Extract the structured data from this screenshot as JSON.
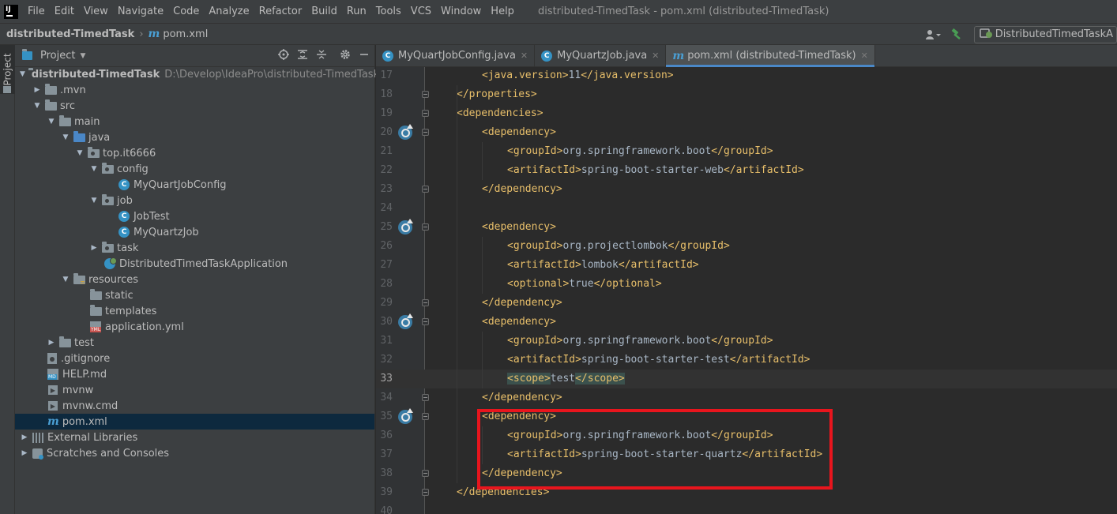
{
  "menubar": {
    "logo": "IJ",
    "items": [
      "File",
      "Edit",
      "View",
      "Navigate",
      "Code",
      "Analyze",
      "Refactor",
      "Build",
      "Run",
      "Tools",
      "VCS",
      "Window",
      "Help"
    ],
    "window_title": "distributed-TimedTask - pom.xml (distributed-TimedTask)"
  },
  "navbar": {
    "project": "distributed-TimedTask",
    "file": "pom.xml",
    "run_config": "DistributedTimedTaskA"
  },
  "strip": {
    "project_label": "Project"
  },
  "panel": {
    "title": "Project"
  },
  "tree": {
    "root_name": "distributed-TimedTask",
    "root_path": "D:\\Develop\\IdeaPro\\distributed-TimedTask",
    "mvn": ".mvn",
    "src": "src",
    "main": "main",
    "java": "java",
    "pkg": "top.it6666",
    "config": "config",
    "config_class": "MyQuartJobConfig",
    "job": "job",
    "job_test": "JobTest",
    "job_quartz": "MyQuartzJob",
    "task": "task",
    "app_class": "DistributedTimedTaskApplication",
    "resources": "resources",
    "static": "static",
    "templates": "templates",
    "application_yml": "application.yml",
    "test": "test",
    "gitignore": ".gitignore",
    "help_md": "HELP.md",
    "mvnw": "mvnw",
    "mvnw_cmd": "mvnw.cmd",
    "pom": "pom.xml",
    "ext_libs": "External Libraries",
    "scratches": "Scratches and Consoles"
  },
  "tabs": [
    {
      "label": "MyQuartJobConfig.java"
    },
    {
      "label": "MyQuartzJob.java"
    },
    {
      "label": "pom.xml (distributed-TimedTask)"
    }
  ],
  "code": {
    "lines": [
      {
        "n": "17",
        "parts": [
          [
            "tag",
            "<java.version>"
          ],
          [
            "text",
            "11"
          ],
          [
            "tag",
            "</java.version>"
          ]
        ]
      },
      {
        "n": "18",
        "parts": [
          [
            "tag",
            "</properties>"
          ]
        ]
      },
      {
        "n": "19",
        "parts": [
          [
            "tag",
            "<dependencies>"
          ]
        ]
      },
      {
        "n": "20",
        "parts": [
          [
            "tag",
            "<dependency>"
          ]
        ]
      },
      {
        "n": "21",
        "parts": [
          [
            "tag",
            "<groupId>"
          ],
          [
            "text",
            "org.springframework.boot"
          ],
          [
            "tag",
            "</groupId>"
          ]
        ]
      },
      {
        "n": "22",
        "parts": [
          [
            "tag",
            "<artifactId>"
          ],
          [
            "text",
            "spring-boot-starter-web"
          ],
          [
            "tag",
            "</artifactId>"
          ]
        ]
      },
      {
        "n": "23",
        "parts": [
          [
            "tag",
            "</dependency>"
          ]
        ]
      },
      {
        "n": "24",
        "parts": []
      },
      {
        "n": "25",
        "parts": [
          [
            "tag",
            "<dependency>"
          ]
        ]
      },
      {
        "n": "26",
        "parts": [
          [
            "tag",
            "<groupId>"
          ],
          [
            "text",
            "org.projectlombok"
          ],
          [
            "tag",
            "</groupId>"
          ]
        ]
      },
      {
        "n": "27",
        "parts": [
          [
            "tag",
            "<artifactId>"
          ],
          [
            "text",
            "lombok"
          ],
          [
            "tag",
            "</artifactId>"
          ]
        ]
      },
      {
        "n": "28",
        "parts": [
          [
            "tag",
            "<optional>"
          ],
          [
            "text",
            "true"
          ],
          [
            "tag",
            "</optional>"
          ]
        ]
      },
      {
        "n": "29",
        "parts": [
          [
            "tag",
            "</dependency>"
          ]
        ]
      },
      {
        "n": "30",
        "parts": [
          [
            "tag",
            "<dependency>"
          ]
        ]
      },
      {
        "n": "31",
        "parts": [
          [
            "tag",
            "<groupId>"
          ],
          [
            "text",
            "org.springframework.boot"
          ],
          [
            "tag",
            "</groupId>"
          ]
        ]
      },
      {
        "n": "32",
        "parts": [
          [
            "tag",
            "<artifactId>"
          ],
          [
            "text",
            "spring-boot-starter-test"
          ],
          [
            "tag",
            "</artifactId>"
          ]
        ]
      },
      {
        "n": "33",
        "parts": [
          [
            "taghl",
            "<scope>"
          ],
          [
            "text",
            "test"
          ],
          [
            "taghl",
            "</scope>"
          ]
        ]
      },
      {
        "n": "34",
        "parts": [
          [
            "tag",
            "</dependency>"
          ]
        ]
      },
      {
        "n": "35",
        "parts": [
          [
            "tag",
            "<dependency>"
          ]
        ]
      },
      {
        "n": "36",
        "parts": [
          [
            "tag",
            "<groupId>"
          ],
          [
            "text",
            "org.springframework.boot"
          ],
          [
            "tag",
            "</groupId>"
          ]
        ]
      },
      {
        "n": "37",
        "parts": [
          [
            "tag",
            "<artifactId>"
          ],
          [
            "text",
            "spring-boot-starter-quartz"
          ],
          [
            "tag",
            "</artifactId>"
          ]
        ]
      },
      {
        "n": "38",
        "parts": [
          [
            "tag",
            "</dependency>"
          ]
        ]
      },
      {
        "n": "39",
        "parts": [
          [
            "tag",
            "</dependencies>"
          ]
        ]
      },
      {
        "n": "40",
        "parts": []
      }
    ]
  },
  "colors": {
    "tag": "#e8bf6a",
    "text": "#a9b7c6",
    "highlight_box": "#e8151d",
    "selection": "#0d293e"
  }
}
